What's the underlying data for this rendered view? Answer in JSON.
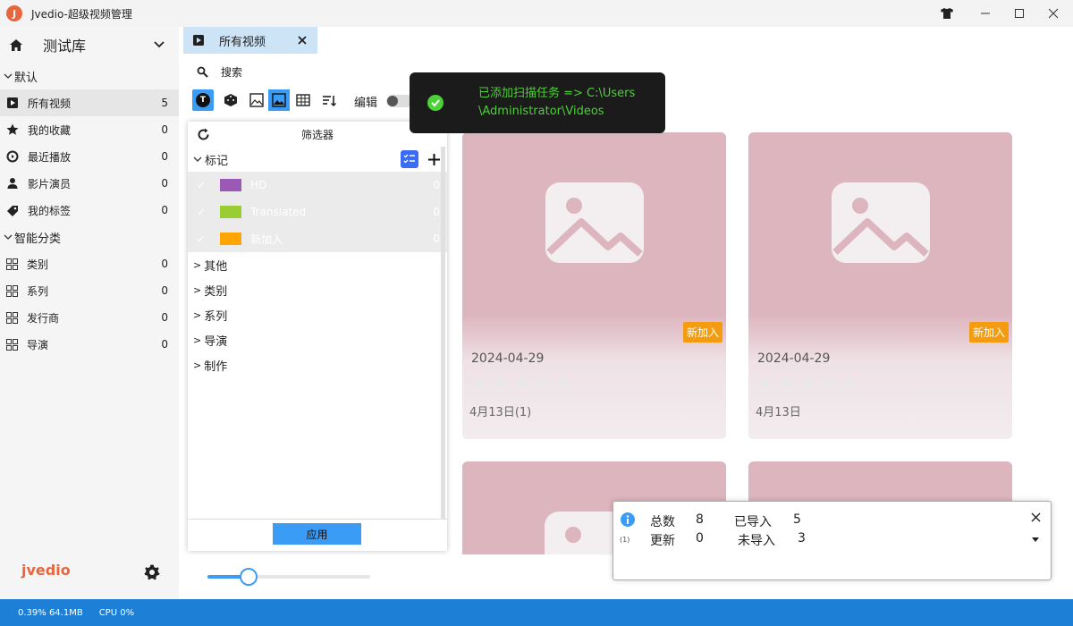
{
  "window": {
    "title": "Jvedio-超级视频管理",
    "logo_letter": "J"
  },
  "sidebar": {
    "library": "测试库",
    "default_section": "默认",
    "items": [
      {
        "label": "所有视频",
        "count": "5",
        "icon": "play-icon"
      },
      {
        "label": "我的收藏",
        "count": "0",
        "icon": "star-icon"
      },
      {
        "label": "最近播放",
        "count": "0",
        "icon": "recent-icon"
      },
      {
        "label": "影片演员",
        "count": "0",
        "icon": "person-icon"
      },
      {
        "label": "我的标签",
        "count": "0",
        "icon": "tag-icon"
      }
    ],
    "smart_section": "智能分类",
    "smart_items": [
      {
        "label": "类别",
        "count": "0"
      },
      {
        "label": "系列",
        "count": "0"
      },
      {
        "label": "发行商",
        "count": "0"
      },
      {
        "label": "导演",
        "count": "0"
      }
    ],
    "brand": "jvedio"
  },
  "tab": {
    "label": "所有视频"
  },
  "toolbar": {
    "search_label": "搜索",
    "edit_label": "编辑",
    "t_badge": "T"
  },
  "filter": {
    "title": "筛选器",
    "tags_header": "标记",
    "tags": [
      {
        "label": "HD",
        "count": "0",
        "color": "#9b59b6"
      },
      {
        "label": "Translated",
        "count": "0",
        "color": "#9acd32"
      },
      {
        "label": "新加入",
        "count": "0",
        "color": "#ffa500"
      }
    ],
    "groups": [
      "其他",
      "类别",
      "系列",
      "导演",
      "制作"
    ],
    "apply_label": "应用"
  },
  "toast": {
    "line1": "已添加扫描任务 => C:\\Users",
    "line2": "\\Administrator\\Videos"
  },
  "cards": [
    {
      "date": "2024-04-29",
      "subtitle": "4月13日(1)",
      "badge": "新加入",
      "rating": 0
    },
    {
      "date": "2024-04-29",
      "subtitle": "4月13日",
      "badge": "新加入",
      "rating": 0
    }
  ],
  "info": {
    "total_label": "总数",
    "total": "8",
    "imported_label": "已导入",
    "imported": "5",
    "update_label": "更新",
    "update": "0",
    "not_imported_label": "未导入",
    "not_imported": "3",
    "page_indicator": "(1)"
  },
  "statusbar": {
    "mem": "0.39% 64.1MB",
    "cpu": "CPU 0%"
  },
  "colors": {
    "accent": "#1d7fd6",
    "toast_text": "#4cd137",
    "card_bg": "#ddb5be",
    "badge": "#f39c12",
    "apply": "#3b9cf5"
  }
}
